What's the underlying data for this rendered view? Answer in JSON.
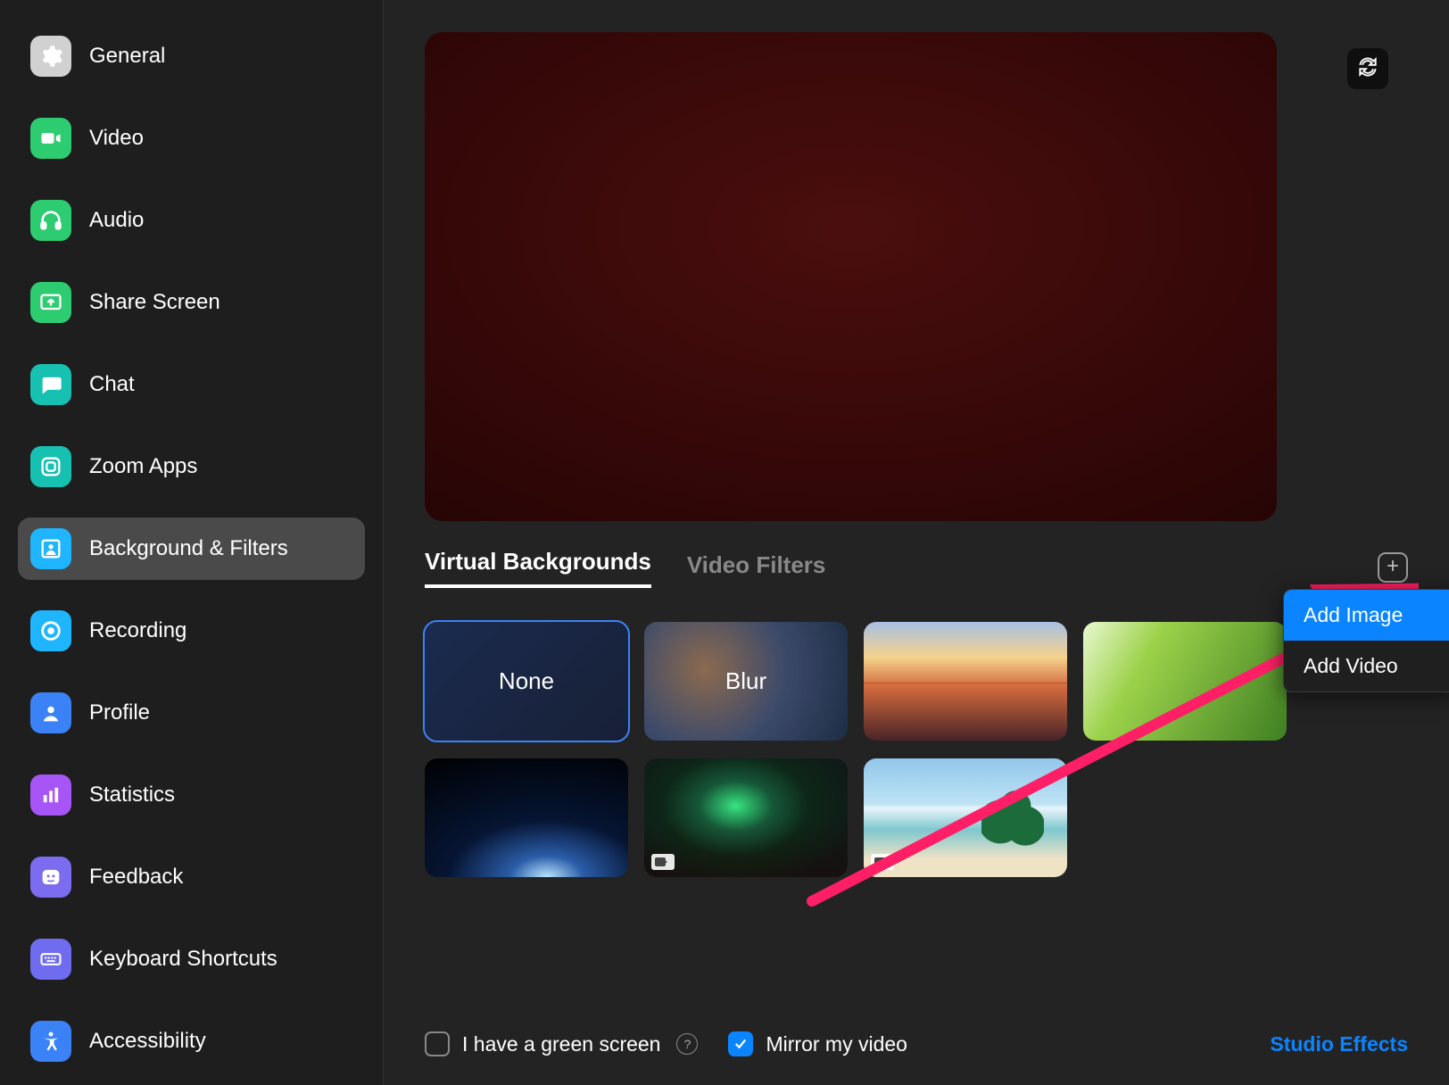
{
  "sidebar": {
    "items": [
      {
        "label": "General"
      },
      {
        "label": "Video"
      },
      {
        "label": "Audio"
      },
      {
        "label": "Share Screen"
      },
      {
        "label": "Chat"
      },
      {
        "label": "Zoom Apps"
      },
      {
        "label": "Background & Filters"
      },
      {
        "label": "Recording"
      },
      {
        "label": "Profile"
      },
      {
        "label": "Statistics"
      },
      {
        "label": "Feedback"
      },
      {
        "label": "Keyboard Shortcuts"
      },
      {
        "label": "Accessibility"
      }
    ],
    "selected_index": 6
  },
  "tabs": {
    "items": [
      "Virtual Backgrounds",
      "Video Filters"
    ],
    "active_index": 0
  },
  "backgrounds": {
    "none_label": "None",
    "blur_label": "Blur"
  },
  "options": {
    "green_screen_label": "I have a green screen",
    "mirror_label": "Mirror my video"
  },
  "studio_effects_label": "Studio Effects",
  "dropdown": {
    "items": [
      "Add Image",
      "Add Video"
    ],
    "highlight_index": 0
  }
}
